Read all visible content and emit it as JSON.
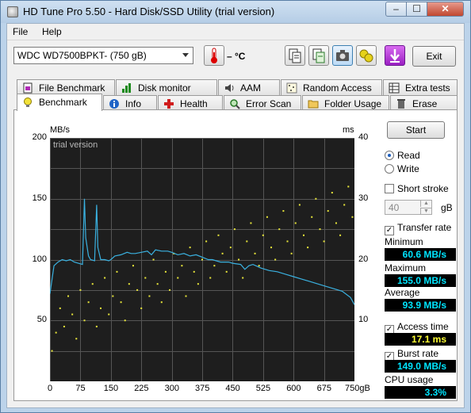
{
  "window": {
    "title": "HD Tune Pro 5.50 - Hard Disk/SSD Utility (trial version)",
    "minimize_label": "–",
    "maximize_label": "☐",
    "close_label": "✕"
  },
  "menu": {
    "file": "File",
    "help": "Help"
  },
  "toolbar": {
    "drive": "WDC WD7500BPKT- (750 gB)",
    "temperature": "– °C",
    "exit_label": "Exit",
    "icons": [
      "thermometer-icon",
      "copy-icon",
      "save-icon",
      "camera-icon",
      "options-icon",
      "download-icon"
    ]
  },
  "tabs_row1": [
    "File Benchmark",
    "Disk monitor",
    "AAM",
    "Random Access",
    "Extra tests"
  ],
  "tabs_row2": [
    "Benchmark",
    "Info",
    "Health",
    "Error Scan",
    "Folder Usage",
    "Erase"
  ],
  "chart_labels": {
    "left_unit": "MB/s",
    "right_unit": "ms",
    "watermark": "trial version"
  },
  "chart_data": {
    "type": "line",
    "xlabel": "",
    "ylabel": "MB/s",
    "x_ticks": [
      "0",
      "75",
      "150",
      "225",
      "300",
      "375",
      "450",
      "525",
      "600",
      "675",
      "750gB"
    ],
    "y_ticks": [
      "200",
      "150",
      "100",
      "50"
    ],
    "y2_ticks": [
      "40",
      "30",
      "20",
      "10"
    ],
    "xlim": [
      0,
      750
    ],
    "ylim": [
      0,
      200
    ],
    "y2lim": [
      0,
      40
    ],
    "grid": true,
    "series": [
      {
        "name": "Transfer rate",
        "color": "#3ab1e0",
        "x": [
          0,
          10,
          20,
          30,
          40,
          50,
          60,
          70,
          80,
          85,
          88,
          95,
          100,
          110,
          115,
          118,
          125,
          135,
          145,
          150,
          160,
          175,
          190,
          200,
          210,
          225,
          240,
          250,
          260,
          275,
          290,
          300,
          315,
          330,
          345,
          360,
          375,
          390,
          400,
          420,
          440,
          450,
          470,
          480,
          490,
          500,
          520,
          540,
          560,
          580,
          600,
          620,
          640,
          660,
          680,
          700,
          720,
          740,
          750
        ],
        "y": [
          72,
          95,
          98,
          100,
          99,
          100,
          98,
          97,
          96,
          150,
          118,
          103,
          100,
          99,
          145,
          110,
          100,
          100,
          99,
          100,
          103,
          104,
          106,
          105,
          105,
          106,
          107,
          104,
          108,
          107,
          107,
          106,
          104,
          105,
          103,
          104,
          102,
          100,
          100,
          98,
          98,
          97,
          96,
          92,
          95,
          96,
          93,
          91,
          90,
          88,
          86,
          84,
          82,
          80,
          78,
          76,
          74,
          69,
          63
        ]
      },
      {
        "name": "Access time",
        "color": "#e8e63a",
        "y_units": "ms",
        "average": 17.1,
        "range": [
          0,
          40
        ],
        "x": [
          5,
          15,
          25,
          35,
          45,
          55,
          65,
          75,
          85,
          95,
          105,
          115,
          125,
          135,
          145,
          155,
          165,
          175,
          185,
          195,
          205,
          215,
          225,
          235,
          245,
          255,
          265,
          275,
          285,
          295,
          305,
          315,
          325,
          335,
          345,
          355,
          365,
          375,
          385,
          395,
          405,
          415,
          425,
          435,
          445,
          455,
          465,
          475,
          485,
          495,
          505,
          515,
          525,
          535,
          545,
          555,
          565,
          575,
          585,
          595,
          605,
          615,
          625,
          635,
          645,
          655,
          665,
          675,
          685,
          695,
          705,
          715,
          725,
          735,
          745
        ],
        "y": [
          5,
          8,
          12,
          9,
          14,
          11,
          7,
          15,
          10,
          13,
          16,
          9,
          12,
          17,
          11,
          14,
          18,
          13,
          10,
          16,
          19,
          15,
          12,
          17,
          14,
          20,
          16,
          13,
          18,
          15,
          21,
          17,
          19,
          14,
          22,
          18,
          16,
          20,
          23,
          17,
          19,
          24,
          21,
          18,
          22,
          25,
          20,
          17,
          23,
          26,
          21,
          19,
          24,
          27,
          22,
          20,
          25,
          28,
          23,
          21,
          26,
          29,
          24,
          22,
          27,
          30,
          25,
          23,
          28,
          31,
          26,
          24,
          29,
          32,
          27
        ]
      }
    ]
  },
  "options": {
    "start_label": "Start",
    "read_label": "Read",
    "write_label": "Write",
    "short_stroke_label": "Short stroke",
    "stroke_value": "40",
    "stroke_unit": "gB",
    "transfer_rate_label": "Transfer rate"
  },
  "stats": {
    "minimum_label": "Minimum",
    "minimum_value": "60.6 MB/s",
    "maximum_label": "Maximum",
    "maximum_value": "155.0 MB/s",
    "average_label": "Average",
    "average_value": "93.9 MB/s",
    "access_time_label": "Access time",
    "access_time_value": "17.1 ms",
    "burst_rate_label": "Burst rate",
    "burst_rate_value": "149.0 MB/s",
    "cpu_usage_label": "CPU usage",
    "cpu_usage_value": "3.3%"
  },
  "colors": {
    "chart_bg": "#1e1e1e",
    "grid": "#555555",
    "stat_value_cyan": "#00e5ff",
    "stat_value_yellow": "#ffff33"
  }
}
